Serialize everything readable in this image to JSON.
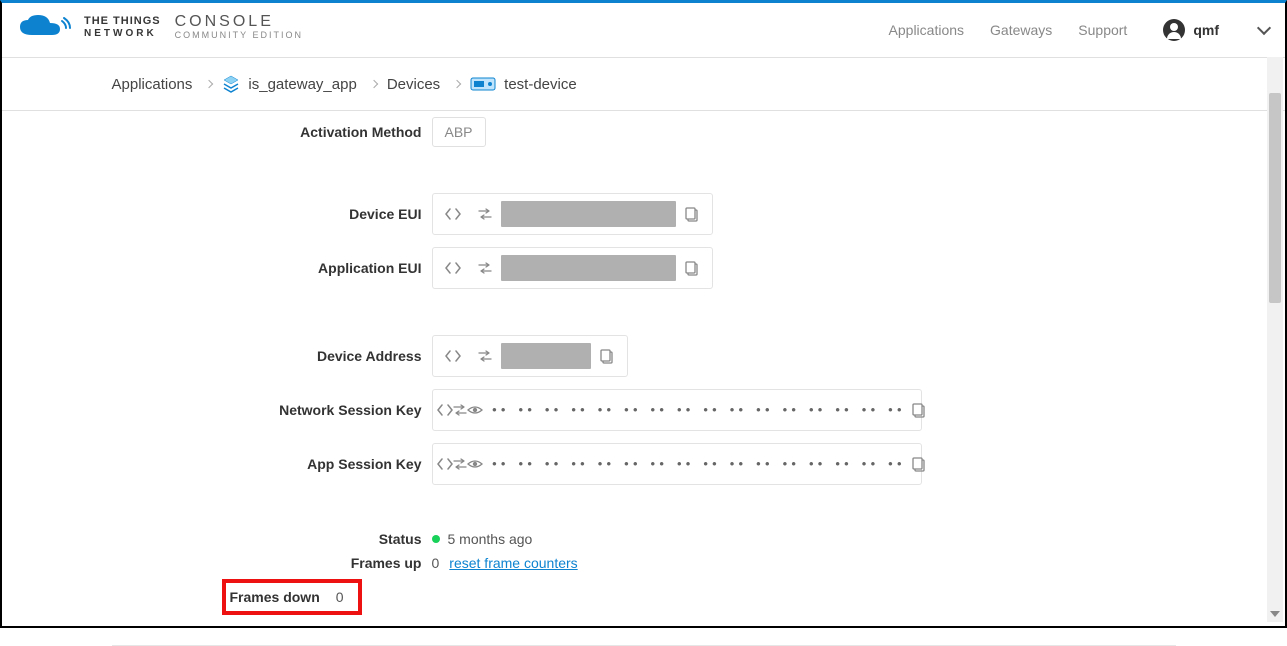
{
  "nav": {
    "brand_line1": "THE THINGS",
    "brand_line2": "NETWORK",
    "console_line1": "CONSOLE",
    "console_line2": "COMMUNITY EDITION",
    "links": {
      "applications": "Applications",
      "gateways": "Gateways",
      "support": "Support"
    },
    "user": "qmf"
  },
  "breadcrumb": {
    "root": "Applications",
    "app": "is_gateway_app",
    "devices": "Devices",
    "device": "test-device"
  },
  "fields": {
    "activation_method": {
      "label": "Activation Method",
      "value": "ABP"
    },
    "device_eui": {
      "label": "Device EUI"
    },
    "application_eui": {
      "label": "Application EUI"
    },
    "device_address": {
      "label": "Device Address"
    },
    "network_session_key": {
      "label": "Network Session Key",
      "masked": "•• •• •• •• •• •• •• •• •• •• •• •• •• •• •• ••"
    },
    "app_session_key": {
      "label": "App Session Key",
      "masked": "•• •• •• •• •• •• •• •• •• •• •• •• •• •• •• ••"
    },
    "status": {
      "label": "Status",
      "value": "5 months ago"
    },
    "frames_up": {
      "label": "Frames up",
      "value": "0",
      "reset_link": "reset frame counters"
    },
    "frames_down": {
      "label": "Frames down",
      "value": "0"
    }
  }
}
